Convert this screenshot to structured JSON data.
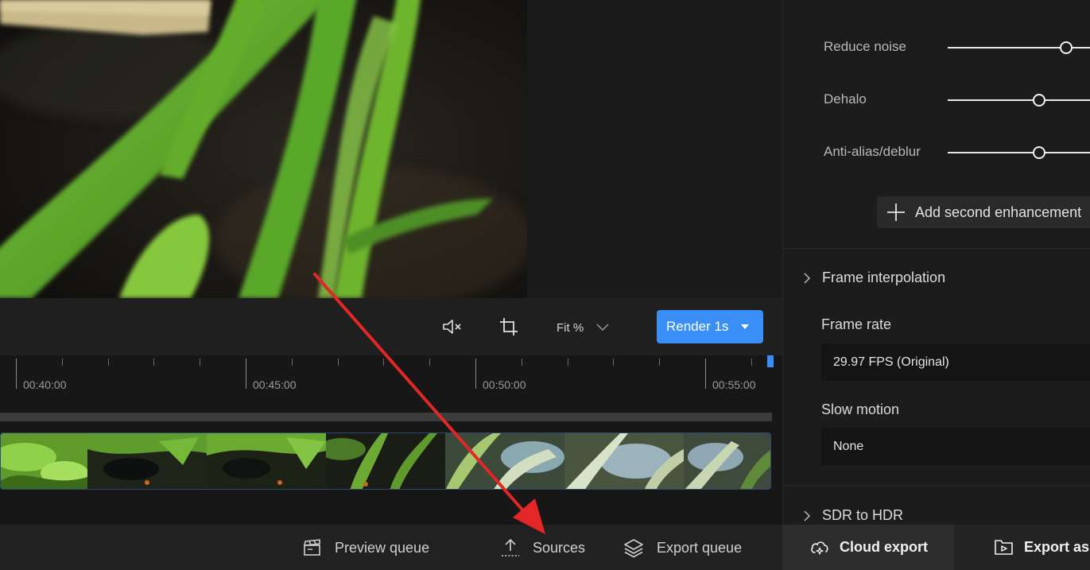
{
  "toolbar": {
    "fit_label": "Fit %",
    "render_label": "Render 1s"
  },
  "timeline": {
    "labels": [
      "00:40:00",
      "00:45:00",
      "00:50:00",
      "00:55:00"
    ]
  },
  "bottom_bar": {
    "preview_queue": "Preview queue",
    "sources": "Sources",
    "export_queue": "Export queue"
  },
  "enhancement": {
    "sliders": [
      {
        "label": "Reduce noise",
        "value": 0.83
      },
      {
        "label": "Dehalo",
        "value": 0.64
      },
      {
        "label": "Anti-alias/deblur",
        "value": 0.64
      }
    ],
    "add_second_label": "Add second enhancement"
  },
  "frame_interpolation": {
    "title": "Frame interpolation",
    "frame_rate_label": "Frame rate",
    "frame_rate_value": "29.97 FPS (Original)",
    "slow_motion_label": "Slow motion",
    "slow_motion_value": "None"
  },
  "sdr_to_hdr": {
    "title": "SDR to HDR"
  },
  "export": {
    "cloud_label": "Cloud export",
    "export_as_label": "Export as"
  },
  "colors": {
    "accent": "#3a8ff7",
    "annotation_arrow": "#e32626"
  }
}
